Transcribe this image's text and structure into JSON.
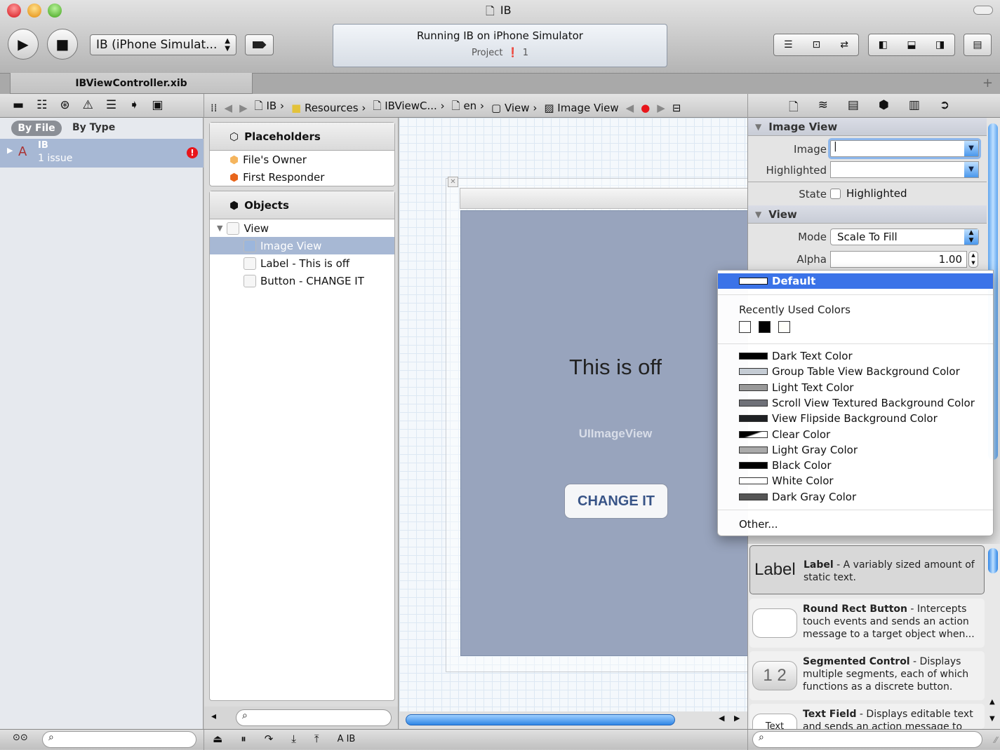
{
  "window": {
    "title": "IB"
  },
  "toolbar": {
    "run": "▶",
    "stop": "■",
    "scheme": "IB (iPhone Simulat...",
    "activity_title": "Running IB on iPhone Simulator",
    "activity_project": "Project",
    "issue_count": "1"
  },
  "tab": {
    "label": "IBViewController.xib"
  },
  "breadcrumb": [
    "IB",
    "Resources",
    "IBViewC...",
    "en",
    "View",
    "Image View"
  ],
  "navigator": {
    "scope_by_file": "By File",
    "scope_by_type": "By Type",
    "project": "IB",
    "issues": "1 issue"
  },
  "outline": {
    "placeholders": "Placeholders",
    "files_owner": "File's Owner",
    "first_responder": "First Responder",
    "objects": "Objects",
    "view": "View",
    "image_view": "Image View",
    "label_item": "Label - This is off",
    "button_item": "Button - CHANGE IT"
  },
  "canvas": {
    "label_text": "This is off",
    "image_view_text": "UIImageView",
    "button_text": "CHANGE IT"
  },
  "inspector": {
    "section_image_view": "Image View",
    "image_label": "Image",
    "image_value": "",
    "highlighted_label": "Highlighted",
    "highlighted_value": "",
    "state_label": "State",
    "state_checkbox": "Highlighted",
    "state_checked": false,
    "section_view": "View",
    "mode_label": "Mode",
    "mode_value": "Scale To Fill",
    "alpha_label": "Alpha",
    "alpha_value": "1.00"
  },
  "color_menu": {
    "default": "Default",
    "recent_header": "Recently Used Colors",
    "recent": [
      "#ffffff",
      "#000000",
      "#fffffa"
    ],
    "items": [
      {
        "label": "Dark Text Color",
        "swatch": "#000000"
      },
      {
        "label": "Group Table View Background Color",
        "swatch": "#c5ccd4"
      },
      {
        "label": "Light Text Color",
        "swatch": "#999999"
      },
      {
        "label": "Scroll View Textured Background Color",
        "swatch": "#6f7178"
      },
      {
        "label": "View Flipside Background Color",
        "swatch": "#1f2124"
      },
      {
        "label": "Clear Color",
        "swatch": "transparent"
      },
      {
        "label": "Light Gray Color",
        "swatch": "#aaaaaa"
      },
      {
        "label": "Black Color",
        "swatch": "#000000"
      },
      {
        "label": "White Color",
        "swatch": "#ffffff"
      },
      {
        "label": "Dark Gray Color",
        "swatch": "#555555"
      }
    ],
    "other": "Other..."
  },
  "library": [
    {
      "icon_text": "Label",
      "title": "Label",
      "desc": " - A variably sized amount of static text."
    },
    {
      "icon_text": "",
      "title": "Round Rect Button",
      "desc": " - Intercepts touch events and sends an action message to a target object when..."
    },
    {
      "icon_text": "1 2",
      "title": "Segmented Control",
      "desc": " - Displays multiple segments, each of which functions as a discrete button."
    },
    {
      "icon_text": "Text",
      "title": "Text Field",
      "desc": " - Displays editable text and sends an action message to a..."
    }
  ],
  "bottom": {
    "debug_target": "IB"
  },
  "colors": {
    "selection": "#3b73e8",
    "nav_selection": "#a7b8d4",
    "view_bg": "#98a4bd",
    "error": "#e8151b"
  }
}
